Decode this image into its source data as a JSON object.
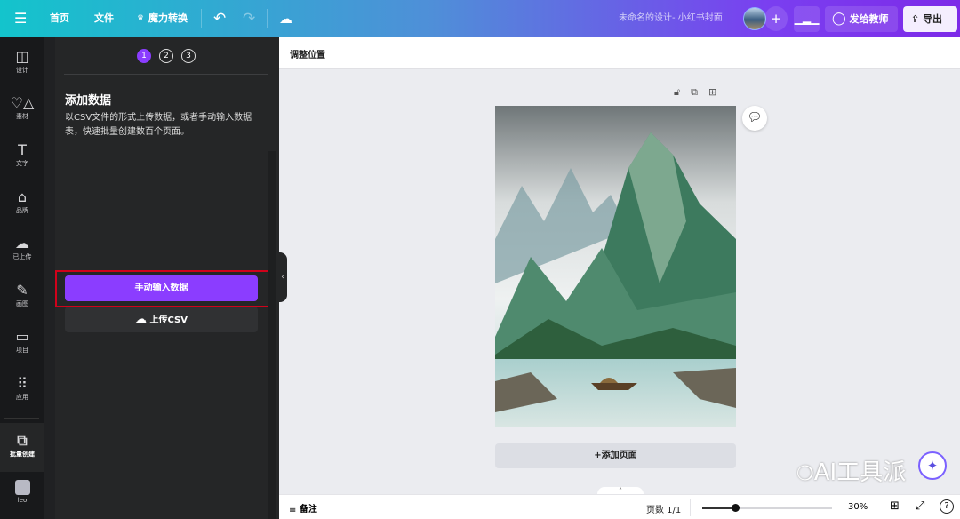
{
  "topbar": {
    "home": "首页",
    "file": "文件",
    "magic": "魔力转换",
    "title": "未命名的设计- 小红书封面",
    "share": "发给教师",
    "export": "导出"
  },
  "rail": [
    {
      "label": "设计",
      "icon": "layout-icon"
    },
    {
      "label": "素材",
      "icon": "shapes-icon"
    },
    {
      "label": "文字",
      "icon": "text-icon"
    },
    {
      "label": "品牌",
      "icon": "brand-icon"
    },
    {
      "label": "已上传",
      "icon": "upload-cloud-icon"
    },
    {
      "label": "画图",
      "icon": "draw-icon"
    },
    {
      "label": "项目",
      "icon": "folder-icon"
    },
    {
      "label": "应用",
      "icon": "apps-grid-icon"
    },
    {
      "label": "批量创建",
      "icon": "bulk-create-icon"
    },
    {
      "label": "leo",
      "icon": "app-thumbnail"
    }
  ],
  "panel": {
    "steps": [
      "1",
      "2",
      "3"
    ],
    "title": "添加数据",
    "desc": "以CSV文件的形式上传数据，或者手动输入数据表，快速批量创建数百个页面。",
    "manual": "手动输入数据",
    "upload": "上传CSV"
  },
  "main": {
    "header": "调整位置",
    "add_page": "+添加页面"
  },
  "bottom": {
    "notes": "备注",
    "pages": "页数 1/1",
    "zoom": "30%",
    "zoom_value": 30
  },
  "watermark": "AI工具派",
  "colors": {
    "accent": "#8b3dff",
    "highlight": "#d0021b"
  }
}
